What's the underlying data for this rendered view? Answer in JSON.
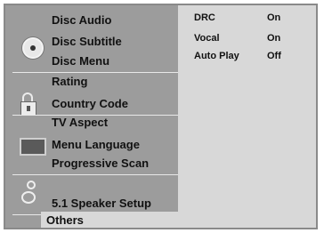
{
  "menu": {
    "items": [
      {
        "label": "Disc Audio"
      },
      {
        "label": "Disc Subtitle"
      },
      {
        "label": "Disc Menu"
      },
      {
        "label": "Rating"
      },
      {
        "label": "Country Code"
      },
      {
        "label": "TV Aspect"
      },
      {
        "label": "Menu Language"
      },
      {
        "label": "Progressive Scan"
      },
      {
        "label": "5.1 Speaker Setup"
      },
      {
        "label": "Others"
      }
    ],
    "selected": "Others"
  },
  "options": [
    {
      "label": "DRC",
      "value": "On"
    },
    {
      "label": "Vocal",
      "value": "On"
    },
    {
      "label": "Auto Play",
      "value": "Off"
    }
  ],
  "icons": [
    "disc-icon",
    "lock-icon",
    "screen-icon",
    "speaker-icon"
  ]
}
